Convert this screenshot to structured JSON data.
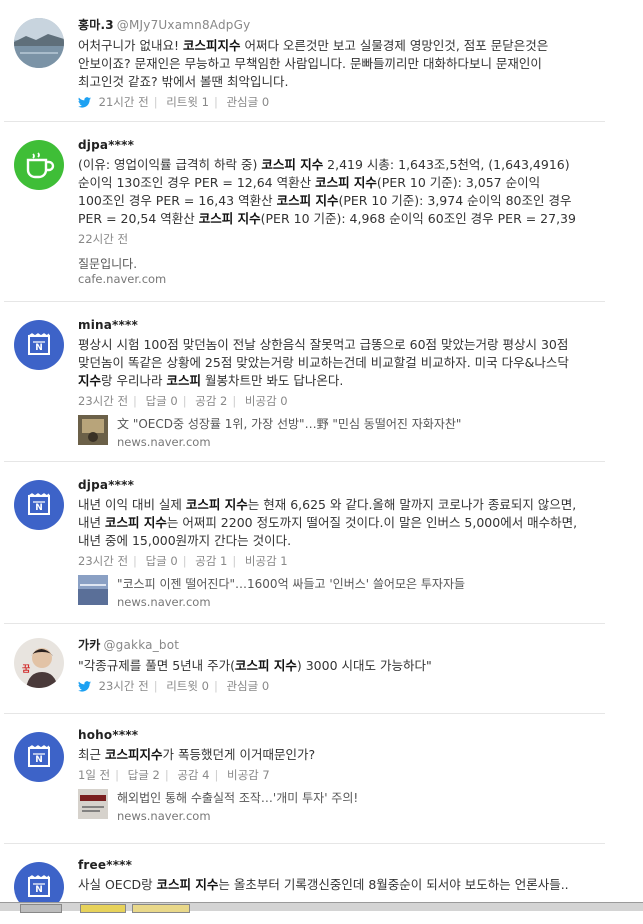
{
  "posts": [
    {
      "name": "홍마.3",
      "handle": "@MJy7Uxamn8AdpGy",
      "body_parts": [
        {
          "t": "어처구니가 없내요! "
        },
        {
          "t": "코스피지수",
          "b": true
        },
        {
          "t": " 어쩌다 오른것만 보고 실물경제 영망인것, 점포 문닫은것은 안보이죠? 문재인은 무능하고 무책임한 사람입니다. 문빠들끼리만 대화하다보니 문재인이 최고인것 같죠? 밖에서 볼땐 최악입니다."
        }
      ],
      "meta": [
        "21시간 전",
        "리트윗 1",
        "관심글 0"
      ]
    },
    {
      "name": "djpa****",
      "body_parts": [
        {
          "t": "(이유: 영업이익률 급격히 하락 중) "
        },
        {
          "t": "코스피 지수",
          "b": true
        },
        {
          "t": " 2,419 시총: 1,643조,5천억, (1,643,4916) 순이익 130조인 경우 PER = 12,64 역환산 "
        },
        {
          "t": "코스피 지수",
          "b": true
        },
        {
          "t": "(PER 10 기준): 3,057 순이익 100조인 경우 PER = 16,43 역환산 "
        },
        {
          "t": "코스피 지수",
          "b": true
        },
        {
          "t": "(PER 10 기준): 3,974 순이익 80조인 경우 PER = 20,54 역환산 "
        },
        {
          "t": "코스피 지수",
          "b": true
        },
        {
          "t": "(PER 10 기준): 4,968 순이익 60조인 경우 PER = 27,39"
        }
      ],
      "time": "22시간 전",
      "note": "질문입니다.",
      "source": "cafe.naver.com"
    },
    {
      "name": "mina****",
      "body_parts": [
        {
          "t": "평상시 시험 100점 맞던놈이 전날 상한음식 잘못먹고 급똥으로 60점 맞았는거랑 평상시 30점 맞던놈이 똑같은 상황에 25점 맞았는거랑 비교하는건데 비교할걸 비교하자. 미국 다우&나스닥 "
        },
        {
          "t": "지수",
          "b": true
        },
        {
          "t": "랑 우리나라 "
        },
        {
          "t": "코스피",
          "b": true
        },
        {
          "t": " 월봉차트만 봐도 답나온다."
        }
      ],
      "meta": [
        "23시간 전",
        "답글 0",
        "공감 2",
        "비공감 0"
      ],
      "link_title": "文 \"OECD중 성장률 1위, 가장 선방\"…野 \"민심 동떨어진 자화자찬\"",
      "source": "news.naver.com"
    },
    {
      "name": "djpa****",
      "body_parts": [
        {
          "t": "내년 이익 대비 실제 "
        },
        {
          "t": "코스피 지수",
          "b": true
        },
        {
          "t": "는 현재 6,625 와 같다.올해 말까지 코로나가 종료되지 않으면,내년 "
        },
        {
          "t": "코스피 지수",
          "b": true
        },
        {
          "t": "는 어쩌피 2200 정도까지 떨어질 것이다.이 말은 인버스 5,000에서 매수하면, 내년 중에 15,000원까지 간다는 것이다."
        }
      ],
      "meta": [
        "23시간 전",
        "답글 0",
        "공감 1",
        "비공감 1"
      ],
      "link_title": "\"코스피 이젠 떨어진다\"…1600억 싸들고 '인버스' 쓸어모은 투자자들",
      "source": "news.naver.com"
    },
    {
      "name": "가카",
      "handle": "@gakka_bot",
      "body_parts": [
        {
          "t": "\"각종규제를 풀면 5년내 주가("
        },
        {
          "t": "코스피 지수",
          "b": true
        },
        {
          "t": ") 3000 시대도 가능하다\""
        }
      ],
      "meta": [
        "23시간 전",
        "리트윗 0",
        "관심글 0"
      ]
    },
    {
      "name": "hoho****",
      "body_parts": [
        {
          "t": "최근 "
        },
        {
          "t": "코스피지수",
          "b": true
        },
        {
          "t": "가 폭등했던게 이거때문인가?"
        }
      ],
      "meta": [
        "1일 전",
        "답글 2",
        "공감 4",
        "비공감 7"
      ],
      "link_title": "해외법인 통해 수출실적 조작…'개미 투자' 주의!",
      "source": "news.naver.com"
    },
    {
      "name": "free****",
      "body_parts": [
        {
          "t": "사실 OECD랑 "
        },
        {
          "t": "코스피 지수",
          "b": true
        },
        {
          "t": "는 올초부터 기록갱신중인데 8월중순이 되서야 보도하는 언론사들.."
        }
      ]
    }
  ],
  "colors": {
    "cafe_green": "#3fbe37",
    "blog_blue": "#3d63c8",
    "twitter_blue": "#1da1f2"
  },
  "icons": [
    "lake-photo-avatar",
    "cafe-cup-icon",
    "news-doc-icon",
    "twitter-bird-icon",
    "portrait-avatar"
  ]
}
